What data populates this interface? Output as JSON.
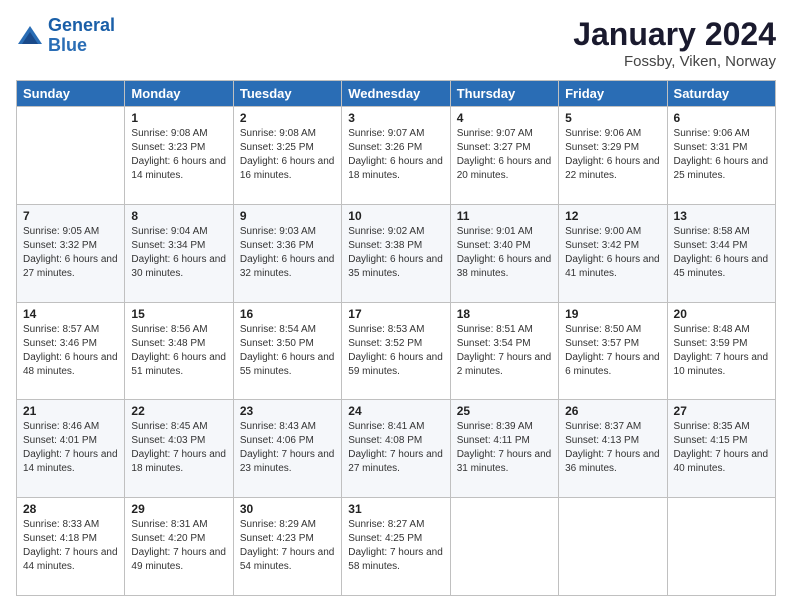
{
  "header": {
    "logo_line1": "General",
    "logo_line2": "Blue",
    "month_title": "January 2024",
    "location": "Fossby, Viken, Norway"
  },
  "calendar": {
    "weekdays": [
      "Sunday",
      "Monday",
      "Tuesday",
      "Wednesday",
      "Thursday",
      "Friday",
      "Saturday"
    ],
    "weeks": [
      [
        {
          "day": "",
          "sunrise": "",
          "sunset": "",
          "daylight": ""
        },
        {
          "day": "1",
          "sunrise": "Sunrise: 9:08 AM",
          "sunset": "Sunset: 3:23 PM",
          "daylight": "Daylight: 6 hours and 14 minutes."
        },
        {
          "day": "2",
          "sunrise": "Sunrise: 9:08 AM",
          "sunset": "Sunset: 3:25 PM",
          "daylight": "Daylight: 6 hours and 16 minutes."
        },
        {
          "day": "3",
          "sunrise": "Sunrise: 9:07 AM",
          "sunset": "Sunset: 3:26 PM",
          "daylight": "Daylight: 6 hours and 18 minutes."
        },
        {
          "day": "4",
          "sunrise": "Sunrise: 9:07 AM",
          "sunset": "Sunset: 3:27 PM",
          "daylight": "Daylight: 6 hours and 20 minutes."
        },
        {
          "day": "5",
          "sunrise": "Sunrise: 9:06 AM",
          "sunset": "Sunset: 3:29 PM",
          "daylight": "Daylight: 6 hours and 22 minutes."
        },
        {
          "day": "6",
          "sunrise": "Sunrise: 9:06 AM",
          "sunset": "Sunset: 3:31 PM",
          "daylight": "Daylight: 6 hours and 25 minutes."
        }
      ],
      [
        {
          "day": "7",
          "sunrise": "Sunrise: 9:05 AM",
          "sunset": "Sunset: 3:32 PM",
          "daylight": "Daylight: 6 hours and 27 minutes."
        },
        {
          "day": "8",
          "sunrise": "Sunrise: 9:04 AM",
          "sunset": "Sunset: 3:34 PM",
          "daylight": "Daylight: 6 hours and 30 minutes."
        },
        {
          "day": "9",
          "sunrise": "Sunrise: 9:03 AM",
          "sunset": "Sunset: 3:36 PM",
          "daylight": "Daylight: 6 hours and 32 minutes."
        },
        {
          "day": "10",
          "sunrise": "Sunrise: 9:02 AM",
          "sunset": "Sunset: 3:38 PM",
          "daylight": "Daylight: 6 hours and 35 minutes."
        },
        {
          "day": "11",
          "sunrise": "Sunrise: 9:01 AM",
          "sunset": "Sunset: 3:40 PM",
          "daylight": "Daylight: 6 hours and 38 minutes."
        },
        {
          "day": "12",
          "sunrise": "Sunrise: 9:00 AM",
          "sunset": "Sunset: 3:42 PM",
          "daylight": "Daylight: 6 hours and 41 minutes."
        },
        {
          "day": "13",
          "sunrise": "Sunrise: 8:58 AM",
          "sunset": "Sunset: 3:44 PM",
          "daylight": "Daylight: 6 hours and 45 minutes."
        }
      ],
      [
        {
          "day": "14",
          "sunrise": "Sunrise: 8:57 AM",
          "sunset": "Sunset: 3:46 PM",
          "daylight": "Daylight: 6 hours and 48 minutes."
        },
        {
          "day": "15",
          "sunrise": "Sunrise: 8:56 AM",
          "sunset": "Sunset: 3:48 PM",
          "daylight": "Daylight: 6 hours and 51 minutes."
        },
        {
          "day": "16",
          "sunrise": "Sunrise: 8:54 AM",
          "sunset": "Sunset: 3:50 PM",
          "daylight": "Daylight: 6 hours and 55 minutes."
        },
        {
          "day": "17",
          "sunrise": "Sunrise: 8:53 AM",
          "sunset": "Sunset: 3:52 PM",
          "daylight": "Daylight: 6 hours and 59 minutes."
        },
        {
          "day": "18",
          "sunrise": "Sunrise: 8:51 AM",
          "sunset": "Sunset: 3:54 PM",
          "daylight": "Daylight: 7 hours and 2 minutes."
        },
        {
          "day": "19",
          "sunrise": "Sunrise: 8:50 AM",
          "sunset": "Sunset: 3:57 PM",
          "daylight": "Daylight: 7 hours and 6 minutes."
        },
        {
          "day": "20",
          "sunrise": "Sunrise: 8:48 AM",
          "sunset": "Sunset: 3:59 PM",
          "daylight": "Daylight: 7 hours and 10 minutes."
        }
      ],
      [
        {
          "day": "21",
          "sunrise": "Sunrise: 8:46 AM",
          "sunset": "Sunset: 4:01 PM",
          "daylight": "Daylight: 7 hours and 14 minutes."
        },
        {
          "day": "22",
          "sunrise": "Sunrise: 8:45 AM",
          "sunset": "Sunset: 4:03 PM",
          "daylight": "Daylight: 7 hours and 18 minutes."
        },
        {
          "day": "23",
          "sunrise": "Sunrise: 8:43 AM",
          "sunset": "Sunset: 4:06 PM",
          "daylight": "Daylight: 7 hours and 23 minutes."
        },
        {
          "day": "24",
          "sunrise": "Sunrise: 8:41 AM",
          "sunset": "Sunset: 4:08 PM",
          "daylight": "Daylight: 7 hours and 27 minutes."
        },
        {
          "day": "25",
          "sunrise": "Sunrise: 8:39 AM",
          "sunset": "Sunset: 4:11 PM",
          "daylight": "Daylight: 7 hours and 31 minutes."
        },
        {
          "day": "26",
          "sunrise": "Sunrise: 8:37 AM",
          "sunset": "Sunset: 4:13 PM",
          "daylight": "Daylight: 7 hours and 36 minutes."
        },
        {
          "day": "27",
          "sunrise": "Sunrise: 8:35 AM",
          "sunset": "Sunset: 4:15 PM",
          "daylight": "Daylight: 7 hours and 40 minutes."
        }
      ],
      [
        {
          "day": "28",
          "sunrise": "Sunrise: 8:33 AM",
          "sunset": "Sunset: 4:18 PM",
          "daylight": "Daylight: 7 hours and 44 minutes."
        },
        {
          "day": "29",
          "sunrise": "Sunrise: 8:31 AM",
          "sunset": "Sunset: 4:20 PM",
          "daylight": "Daylight: 7 hours and 49 minutes."
        },
        {
          "day": "30",
          "sunrise": "Sunrise: 8:29 AM",
          "sunset": "Sunset: 4:23 PM",
          "daylight": "Daylight: 7 hours and 54 minutes."
        },
        {
          "day": "31",
          "sunrise": "Sunrise: 8:27 AM",
          "sunset": "Sunset: 4:25 PM",
          "daylight": "Daylight: 7 hours and 58 minutes."
        },
        {
          "day": "",
          "sunrise": "",
          "sunset": "",
          "daylight": ""
        },
        {
          "day": "",
          "sunrise": "",
          "sunset": "",
          "daylight": ""
        },
        {
          "day": "",
          "sunrise": "",
          "sunset": "",
          "daylight": ""
        }
      ]
    ]
  }
}
